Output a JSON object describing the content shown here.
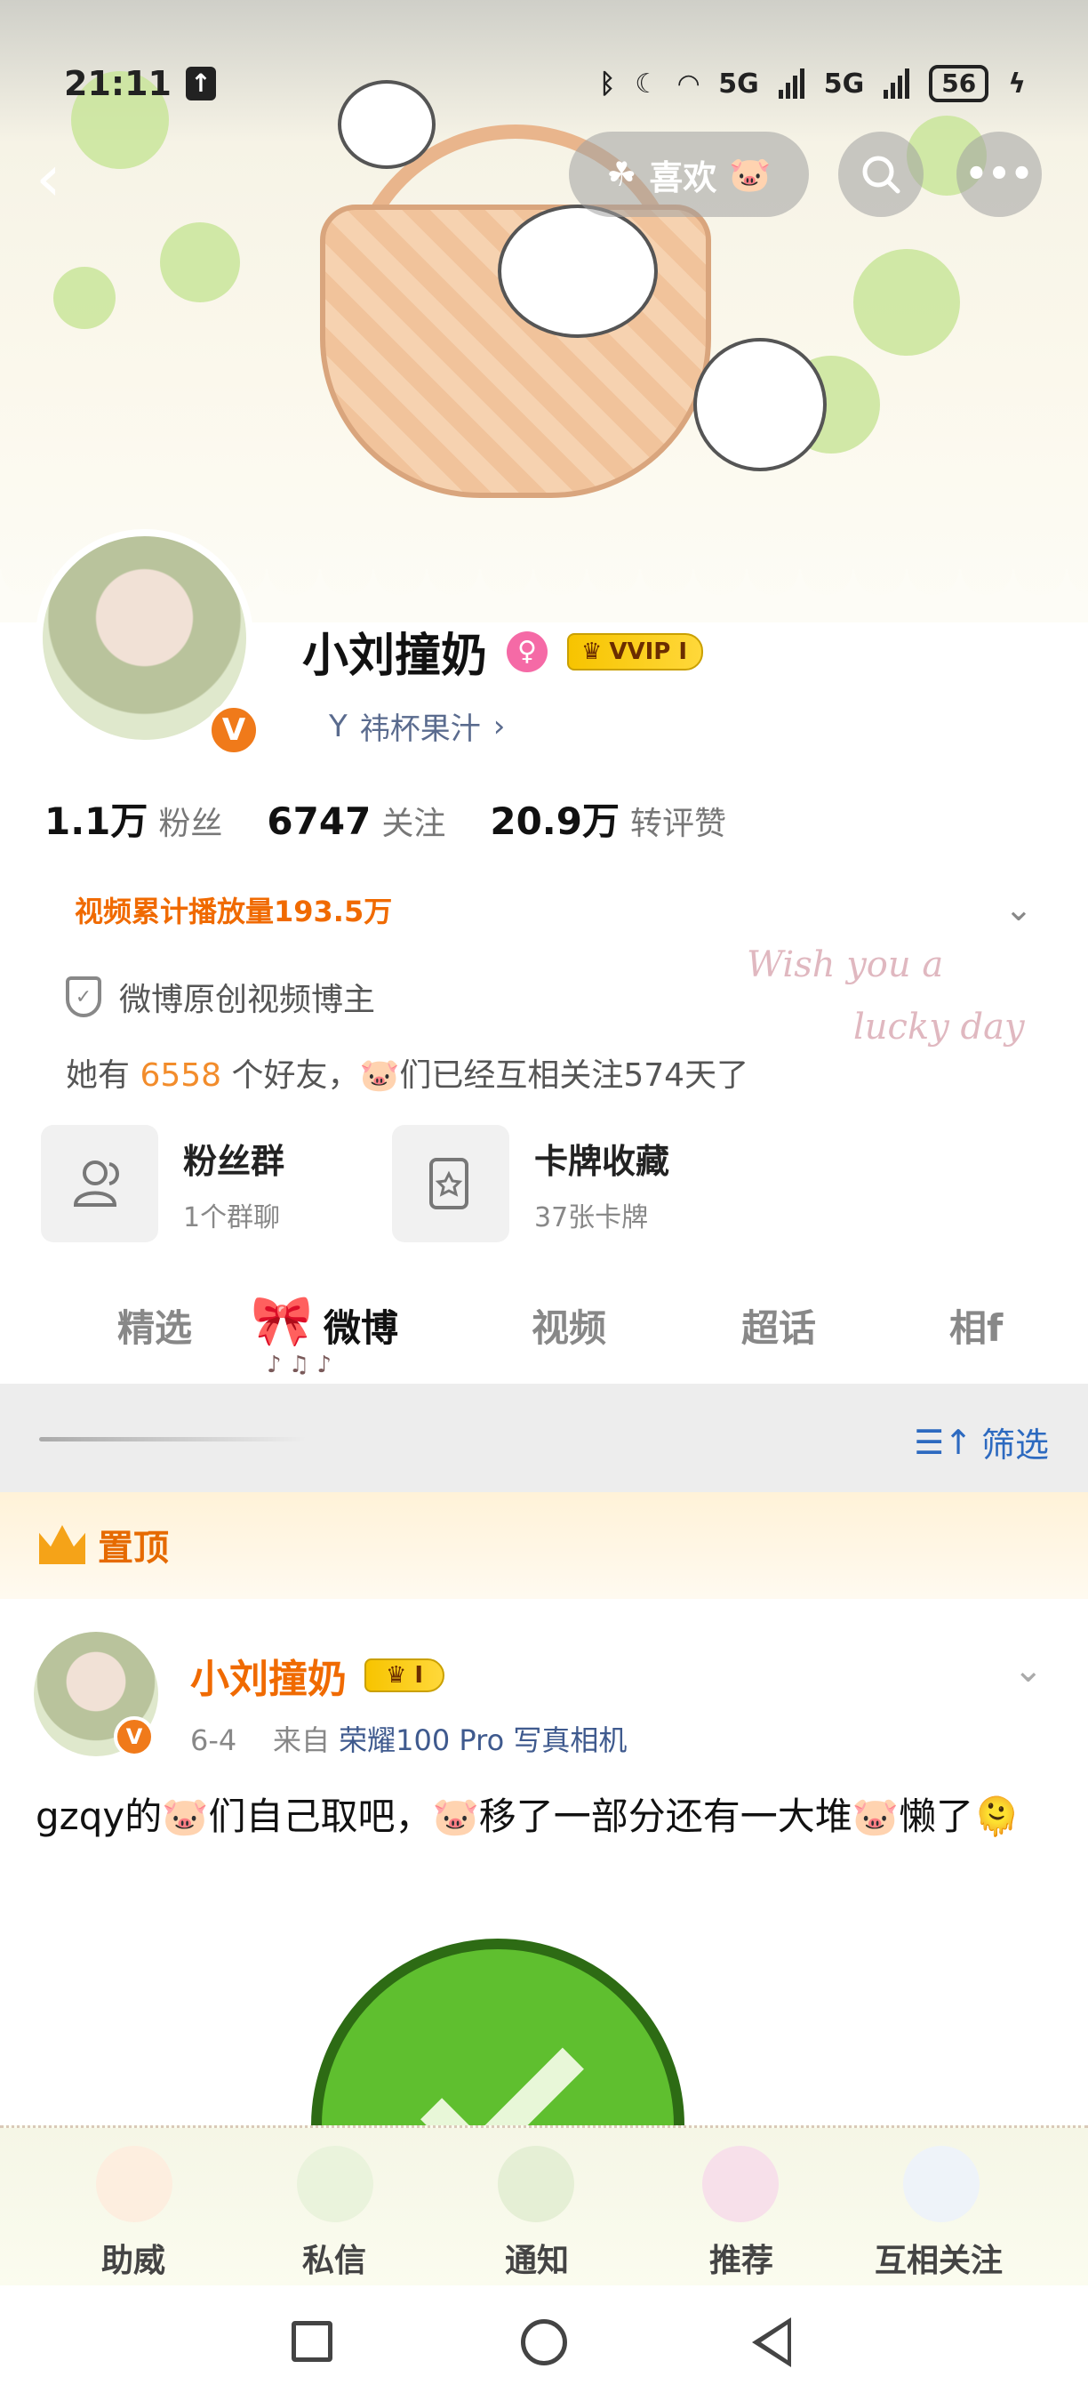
{
  "status_bar": {
    "time": "21:11",
    "network_1": "5G",
    "network_2": "5G",
    "battery": "56"
  },
  "header": {
    "like_label": "喜欢",
    "more_label": "•••"
  },
  "profile": {
    "username": "小刘撞奶",
    "gender_symbol": "♀",
    "vip_label": "VVIP I",
    "verified_symbol": "V",
    "group_name": "祎杯果汁",
    "stats": [
      {
        "num": "1.1万",
        "label": "粉丝"
      },
      {
        "num": "6747",
        "label": "关注"
      },
      {
        "num": "20.9万",
        "label": "转评赞"
      }
    ],
    "play_count_label": "视频累计播放量193.5万",
    "certification": "微博原创视频博主",
    "friends_prefix": "她有",
    "friends_count": "6558",
    "friends_suffix": "个好友，🐷们已经互相关注574天了",
    "wish_line1": "Wish you a",
    "wish_line2": "lucky day"
  },
  "cards": [
    {
      "title": "粉丝群",
      "sub": "1个群聊",
      "icon": "group-icon"
    },
    {
      "title": "卡牌收藏",
      "sub": "37张卡牌",
      "icon": "card-icon"
    }
  ],
  "tabs": [
    "精选",
    "微博",
    "视频",
    "超话",
    "相f"
  ],
  "filter_label": "筛选",
  "pinned_label": "置顶",
  "post": {
    "author": "小刘撞奶",
    "vip_label": "I",
    "date": "6-4",
    "from_prefix": "来自",
    "source": "荣耀100 Pro 写真相机",
    "text": "gzqy的🐷们自己取吧，🐷移了一部分还有一大堆🐷懒了🫠"
  },
  "bottom_tabs": [
    "助威",
    "私信",
    "通知",
    "推荐",
    "互相关注"
  ],
  "colors": {
    "accent_orange": "#f06a00",
    "link_blue": "#2d6ac0",
    "vip_gold": "#f7c400"
  }
}
